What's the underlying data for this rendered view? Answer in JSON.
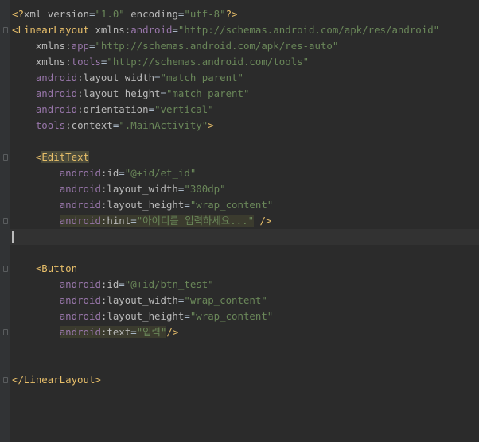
{
  "editor": {
    "lines": [
      {
        "id": "l1",
        "indent": "",
        "segs": [
          {
            "c": "t",
            "t": "<?"
          },
          {
            "c": "an",
            "t": "xml version"
          },
          {
            "c": "pl",
            "t": "="
          },
          {
            "c": "av",
            "t": "\"1.0\""
          },
          {
            "c": "an",
            "t": " encoding"
          },
          {
            "c": "pl",
            "t": "="
          },
          {
            "c": "av",
            "t": "\"utf-8\""
          },
          {
            "c": "t",
            "t": "?>"
          }
        ]
      },
      {
        "id": "l2",
        "indent": "",
        "segs": [
          {
            "c": "t",
            "t": "<LinearLayout "
          },
          {
            "c": "an",
            "t": "xmlns:"
          },
          {
            "c": "ns",
            "t": "android"
          },
          {
            "c": "pl",
            "t": "="
          },
          {
            "c": "av",
            "t": "\"http://schemas.android.com/apk/res/android\""
          }
        ]
      },
      {
        "id": "l3",
        "indent": "    ",
        "segs": [
          {
            "c": "an",
            "t": "xmlns:"
          },
          {
            "c": "ns",
            "t": "app"
          },
          {
            "c": "pl",
            "t": "="
          },
          {
            "c": "av",
            "t": "\"http://schemas.android.com/apk/res-auto\""
          }
        ]
      },
      {
        "id": "l4",
        "indent": "    ",
        "segs": [
          {
            "c": "an",
            "t": "xmlns:"
          },
          {
            "c": "ns",
            "t": "tools"
          },
          {
            "c": "pl",
            "t": "="
          },
          {
            "c": "av",
            "t": "\"http://schemas.android.com/tools\""
          }
        ]
      },
      {
        "id": "l5",
        "indent": "    ",
        "segs": [
          {
            "c": "ns",
            "t": "android"
          },
          {
            "c": "an",
            "t": ":layout_width"
          },
          {
            "c": "pl",
            "t": "="
          },
          {
            "c": "av",
            "t": "\"match_parent\""
          }
        ]
      },
      {
        "id": "l6",
        "indent": "    ",
        "segs": [
          {
            "c": "ns",
            "t": "android"
          },
          {
            "c": "an",
            "t": ":layout_height"
          },
          {
            "c": "pl",
            "t": "="
          },
          {
            "c": "av",
            "t": "\"match_parent\""
          }
        ]
      },
      {
        "id": "l7",
        "indent": "    ",
        "segs": [
          {
            "c": "ns",
            "t": "android"
          },
          {
            "c": "an",
            "t": ":orientation"
          },
          {
            "c": "pl",
            "t": "="
          },
          {
            "c": "av",
            "t": "\"vertical\""
          }
        ]
      },
      {
        "id": "l8",
        "indent": "    ",
        "segs": [
          {
            "c": "ns",
            "t": "tools"
          },
          {
            "c": "an",
            "t": ":context"
          },
          {
            "c": "pl",
            "t": "="
          },
          {
            "c": "av",
            "t": "\".MainActivity\""
          },
          {
            "c": "t",
            "t": ">"
          }
        ]
      },
      {
        "id": "l9",
        "indent": "",
        "segs": []
      },
      {
        "id": "l10",
        "indent": "    ",
        "segs": [
          {
            "c": "t",
            "t": "<"
          },
          {
            "c": "t hl2",
            "t": "EditText"
          }
        ]
      },
      {
        "id": "l11",
        "indent": "        ",
        "segs": [
          {
            "c": "ns",
            "t": "android"
          },
          {
            "c": "an",
            "t": ":id"
          },
          {
            "c": "pl",
            "t": "="
          },
          {
            "c": "av",
            "t": "\"@+id/et_id\""
          }
        ]
      },
      {
        "id": "l12",
        "indent": "        ",
        "segs": [
          {
            "c": "ns",
            "t": "android"
          },
          {
            "c": "an",
            "t": ":layout_width"
          },
          {
            "c": "pl",
            "t": "="
          },
          {
            "c": "av",
            "t": "\"300dp\""
          }
        ]
      },
      {
        "id": "l13",
        "indent": "        ",
        "segs": [
          {
            "c": "ns",
            "t": "android"
          },
          {
            "c": "an",
            "t": ":layout_height"
          },
          {
            "c": "pl",
            "t": "="
          },
          {
            "c": "av",
            "t": "\"wrap_content\""
          }
        ]
      },
      {
        "id": "l14",
        "indent": "        ",
        "segs": [
          {
            "c": "ns hl",
            "t": "android"
          },
          {
            "c": "an hl",
            "t": ":hint"
          },
          {
            "c": "pl hl",
            "t": "="
          },
          {
            "c": "av hl",
            "t": "\"아이디를 입력하세요...\""
          },
          {
            "c": "t",
            "t": " />"
          }
        ]
      },
      {
        "id": "l15",
        "indent": "",
        "segs": []
      },
      {
        "id": "l16",
        "indent": "",
        "segs": []
      },
      {
        "id": "l17",
        "indent": "    ",
        "segs": [
          {
            "c": "t",
            "t": "<Button"
          }
        ]
      },
      {
        "id": "l18",
        "indent": "        ",
        "segs": [
          {
            "c": "ns",
            "t": "android"
          },
          {
            "c": "an",
            "t": ":id"
          },
          {
            "c": "pl",
            "t": "="
          },
          {
            "c": "av",
            "t": "\"@+id/btn_test\""
          }
        ]
      },
      {
        "id": "l19",
        "indent": "        ",
        "segs": [
          {
            "c": "ns",
            "t": "android"
          },
          {
            "c": "an",
            "t": ":layout_width"
          },
          {
            "c": "pl",
            "t": "="
          },
          {
            "c": "av",
            "t": "\"wrap_content\""
          }
        ]
      },
      {
        "id": "l20",
        "indent": "        ",
        "segs": [
          {
            "c": "ns",
            "t": "android"
          },
          {
            "c": "an",
            "t": ":layout_height"
          },
          {
            "c": "pl",
            "t": "="
          },
          {
            "c": "av",
            "t": "\"wrap_content\""
          }
        ]
      },
      {
        "id": "l21",
        "indent": "        ",
        "segs": [
          {
            "c": "ns hl",
            "t": "android"
          },
          {
            "c": "an hl",
            "t": ":text"
          },
          {
            "c": "pl hl",
            "t": "="
          },
          {
            "c": "av hl",
            "t": "\"입력\""
          },
          {
            "c": "t",
            "t": "/>"
          }
        ]
      },
      {
        "id": "l22",
        "indent": "",
        "segs": []
      },
      {
        "id": "l23",
        "indent": "",
        "segs": []
      },
      {
        "id": "l24",
        "indent": "",
        "segs": [
          {
            "c": "t",
            "t": "</LinearLayout>"
          }
        ]
      }
    ]
  },
  "colors": {
    "background": "#2b2b2b",
    "gutter": "#313335",
    "tag": "#e8bf6a",
    "namespace": "#9876aa",
    "attribute": "#bababa",
    "value": "#6a8759"
  }
}
